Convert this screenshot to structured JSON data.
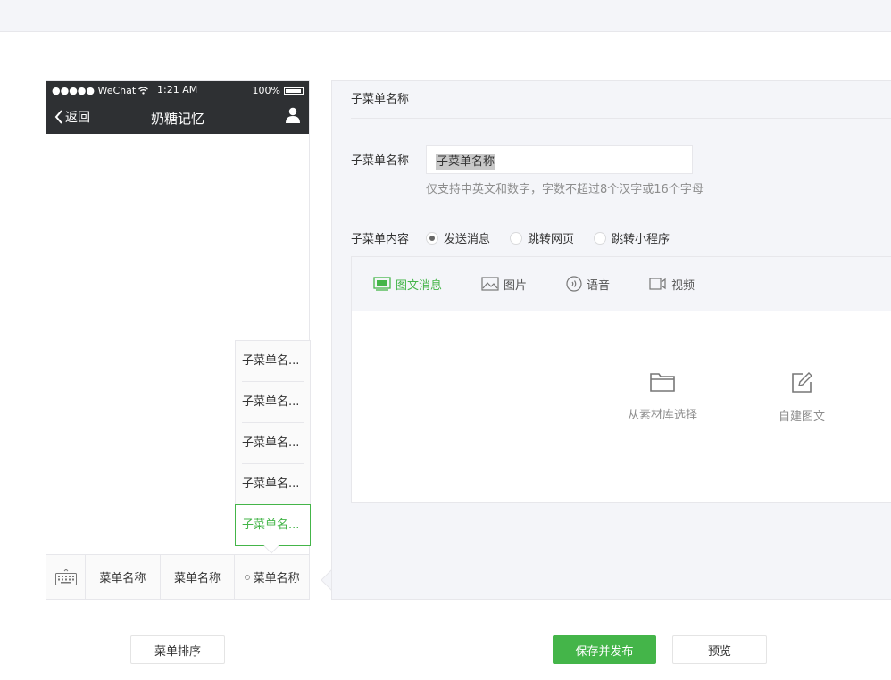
{
  "colors": {
    "accent": "#44b549",
    "phone_bar": "#2e3033",
    "panel_bg": "#f4f5f9",
    "border": "#e7e7eb"
  },
  "phone": {
    "status": {
      "carrier": "●●●●● WeChat",
      "time": "1:21 AM",
      "battery": "100%"
    },
    "back_label": "返回",
    "account_name": "奶糖记忆",
    "submenu_items": [
      "子菜单名...",
      "子菜单名...",
      "子菜单名...",
      "子菜单名...",
      "子菜单名..."
    ],
    "menu_tabs": [
      "菜单名称",
      "菜单名称",
      "菜单名称"
    ]
  },
  "editor": {
    "header": "子菜单名称",
    "name_label": "子菜单名称",
    "name_value": "子菜单名称",
    "name_hint": "仅支持中英文和数字，字数不超过8个汉字或16个字母",
    "content_label": "子菜单内容",
    "radios": [
      {
        "label": "发送消息",
        "selected": true
      },
      {
        "label": "跳转网页",
        "selected": false
      },
      {
        "label": "跳转小程序",
        "selected": false
      }
    ],
    "content_tabs": [
      {
        "label": "图文消息",
        "icon": "news-icon"
      },
      {
        "label": "图片",
        "icon": "image-icon"
      },
      {
        "label": "语音",
        "icon": "voice-icon"
      },
      {
        "label": "视频",
        "icon": "video-icon"
      }
    ],
    "pick_library": "从素材库选择",
    "pick_create": "自建图文"
  },
  "buttons": {
    "sort": "菜单排序",
    "save_publish": "保存并发布",
    "preview": "预览"
  }
}
